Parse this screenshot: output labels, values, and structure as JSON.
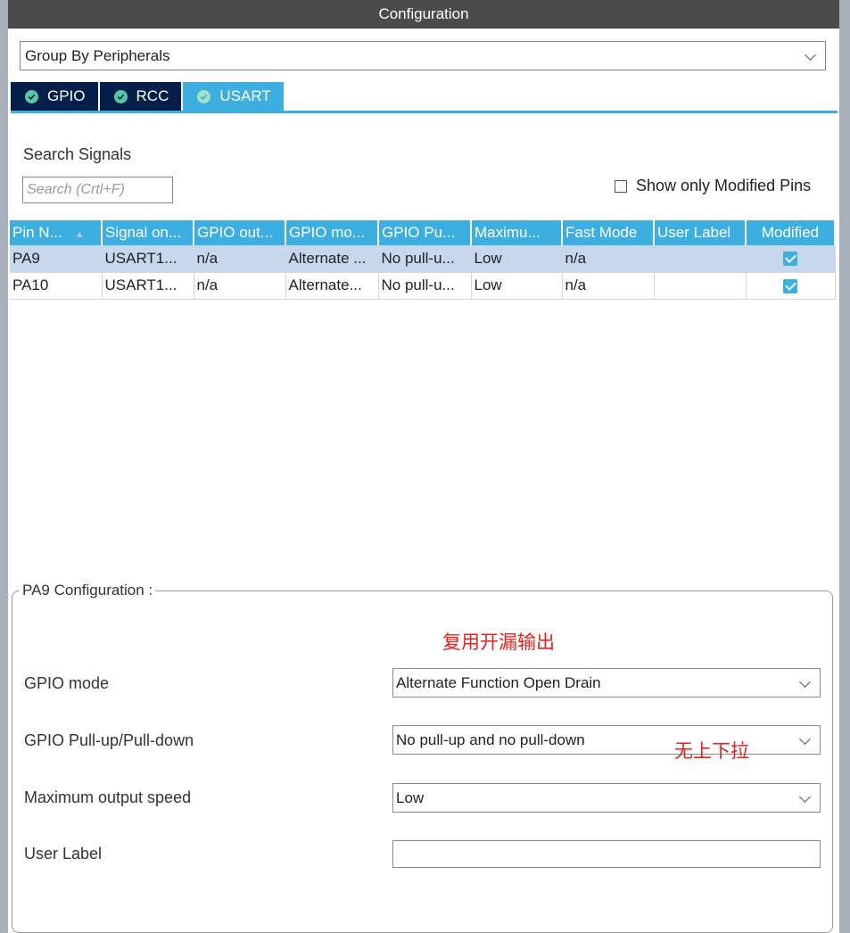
{
  "window": {
    "title": "Configuration"
  },
  "group_select": {
    "value": "Group By Peripherals",
    "icon": "chevron-down-icon"
  },
  "tabs": [
    {
      "label": "GPIO",
      "icon": "check-circle-icon",
      "active": false
    },
    {
      "label": "RCC",
      "icon": "check-circle-icon",
      "active": false
    },
    {
      "label": "USART",
      "icon": "check-circle-icon",
      "active": true
    }
  ],
  "search": {
    "title": "Search Signals",
    "placeholder": "Search (Crtl+F)"
  },
  "modified_filter": {
    "label": "Show only Modified Pins",
    "checked": false
  },
  "table": {
    "columns": [
      "Pin N...",
      "Signal on...",
      "GPIO out...",
      "GPIO mo...",
      "GPIO Pu...",
      "Maximu...",
      "Fast Mode",
      "User Label",
      "Modified"
    ],
    "rows": [
      {
        "pin": "PA9",
        "signal": "USART1...",
        "output": "n/a",
        "mode": "Alternate ...",
        "pull": "No pull-u...",
        "speed": "Low",
        "fast_mode": "n/a",
        "user_label": "",
        "modified": true,
        "selected": true
      },
      {
        "pin": "PA10",
        "signal": "USART1...",
        "output": "n/a",
        "mode": "Alternate...",
        "pull": "No pull-u...",
        "speed": "Low",
        "fast_mode": "n/a",
        "user_label": "",
        "modified": true,
        "selected": false
      }
    ]
  },
  "pin_config": {
    "legend": "PA9 Configuration :",
    "gpio_mode": {
      "label": "GPIO mode",
      "value": "Alternate Function Open Drain"
    },
    "pull": {
      "label": "GPIO Pull-up/Pull-down",
      "value": "No pull-up and no pull-down"
    },
    "speed": {
      "label": "Maximum output speed",
      "value": "Low"
    },
    "user_label": {
      "label": "User Label",
      "value": ""
    }
  },
  "annotations": {
    "mode_note": "复用开漏输出",
    "pull_note": "无上下拉"
  },
  "colors": {
    "accent": "#3daee0",
    "tab_dark": "#04204a",
    "titlebar": "#4b4b4b",
    "selected_row": "#c6d7ee",
    "annotation": "#e8221b"
  }
}
